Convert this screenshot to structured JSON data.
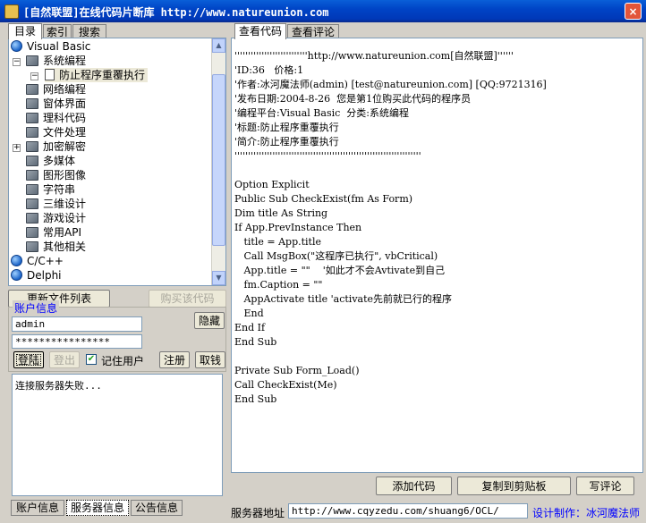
{
  "window": {
    "title": "[自然联盟]在线代码片断库   http://www.natureunion.com",
    "close_glyph": "×"
  },
  "left_tabs": [
    "目录",
    "索引",
    "搜索"
  ],
  "right_tabs": [
    "查看代码",
    "查看评论"
  ],
  "tree": [
    {
      "label": "Visual Basic",
      "icon": "globe-icon",
      "expanded": true
    },
    {
      "label": "系统编程",
      "icon": "book-icon",
      "expanded": true
    },
    {
      "label": "防止程序重覆执行",
      "icon": "document-icon",
      "selected": true
    },
    {
      "label": "网络编程",
      "icon": "book-icon"
    },
    {
      "label": "窗体界面",
      "icon": "book-icon"
    },
    {
      "label": "理科代码",
      "icon": "book-icon"
    },
    {
      "label": "文件处理",
      "icon": "book-icon"
    },
    {
      "label": "加密解密",
      "icon": "book-icon",
      "collapsed": true
    },
    {
      "label": "多媒体",
      "icon": "book-icon"
    },
    {
      "label": "图形图像",
      "icon": "book-icon"
    },
    {
      "label": "字符串",
      "icon": "book-icon"
    },
    {
      "label": "三维设计",
      "icon": "book-icon"
    },
    {
      "label": "游戏设计",
      "icon": "book-icon"
    },
    {
      "label": "常用API",
      "icon": "book-icon"
    },
    {
      "label": "其他相关",
      "icon": "book-icon"
    },
    {
      "label": "C/C++",
      "icon": "globe-icon"
    },
    {
      "label": "Delphi",
      "icon": "globe-icon"
    }
  ],
  "buttons": {
    "update_list": "更新文件列表",
    "buy_code": "购买该代码",
    "hide": "隐藏",
    "login": "登陆",
    "logout": "登出",
    "register": "注册",
    "withdraw": "取钱",
    "add_code": "添加代码",
    "copy_clipboard": "复制到剪贴板",
    "write_comment": "写评论"
  },
  "account": {
    "group_label": "账户信息",
    "username": "admin",
    "password": "****************",
    "remember_label": "记住用户",
    "remember_checked": true
  },
  "status_text": "连接服务器失败...",
  "bottom_tabs": [
    "账户信息",
    "服务器信息",
    "公告信息"
  ],
  "server": {
    "label": "服务器地址",
    "url": "http://www.cqyzedu.com/shuang6/OCL/"
  },
  "credit": "设计制作：冰河魔法师",
  "code_lines": [
    "'''''''''''''''''''''''''''http://www.natureunion.com[自然联盟]''''''",
    "'ID:36   价格:1",
    "'作者:冰河魔法师(admin) [test@natureunion.com] [QQ:9721316]",
    "'发布日期:2004-8-26  您是第1位购买此代码的程序员",
    "'编程平台:Visual Basic  分类:系统编程",
    "'标题:防止程序重覆执行",
    "'简介:防止程序重覆执行",
    "'''''''''''''''''''''''''''''''''''''''''''''''''''''''''''''''''''''",
    "",
    "Option Explicit",
    "Public Sub CheckExist(fm As Form)",
    "Dim title As String",
    "If App.PrevInstance Then",
    "   title = App.title",
    "   Call MsgBox(\"这程序已执行\", vbCritical)",
    "   App.title = \"\"    '如此才不会Avtivate到自己",
    "   fm.Caption = \"\"",
    "   AppActivate title 'activate先前就已行的程序",
    "   End",
    "End If",
    "End Sub",
    "",
    "Private Sub Form_Load()",
    "Call CheckExist(Me)",
    "End Sub"
  ],
  "colors": {
    "titlebar": "#0044c6",
    "window_bg": "#d4d0c8",
    "accent_link": "#0000ff"
  }
}
